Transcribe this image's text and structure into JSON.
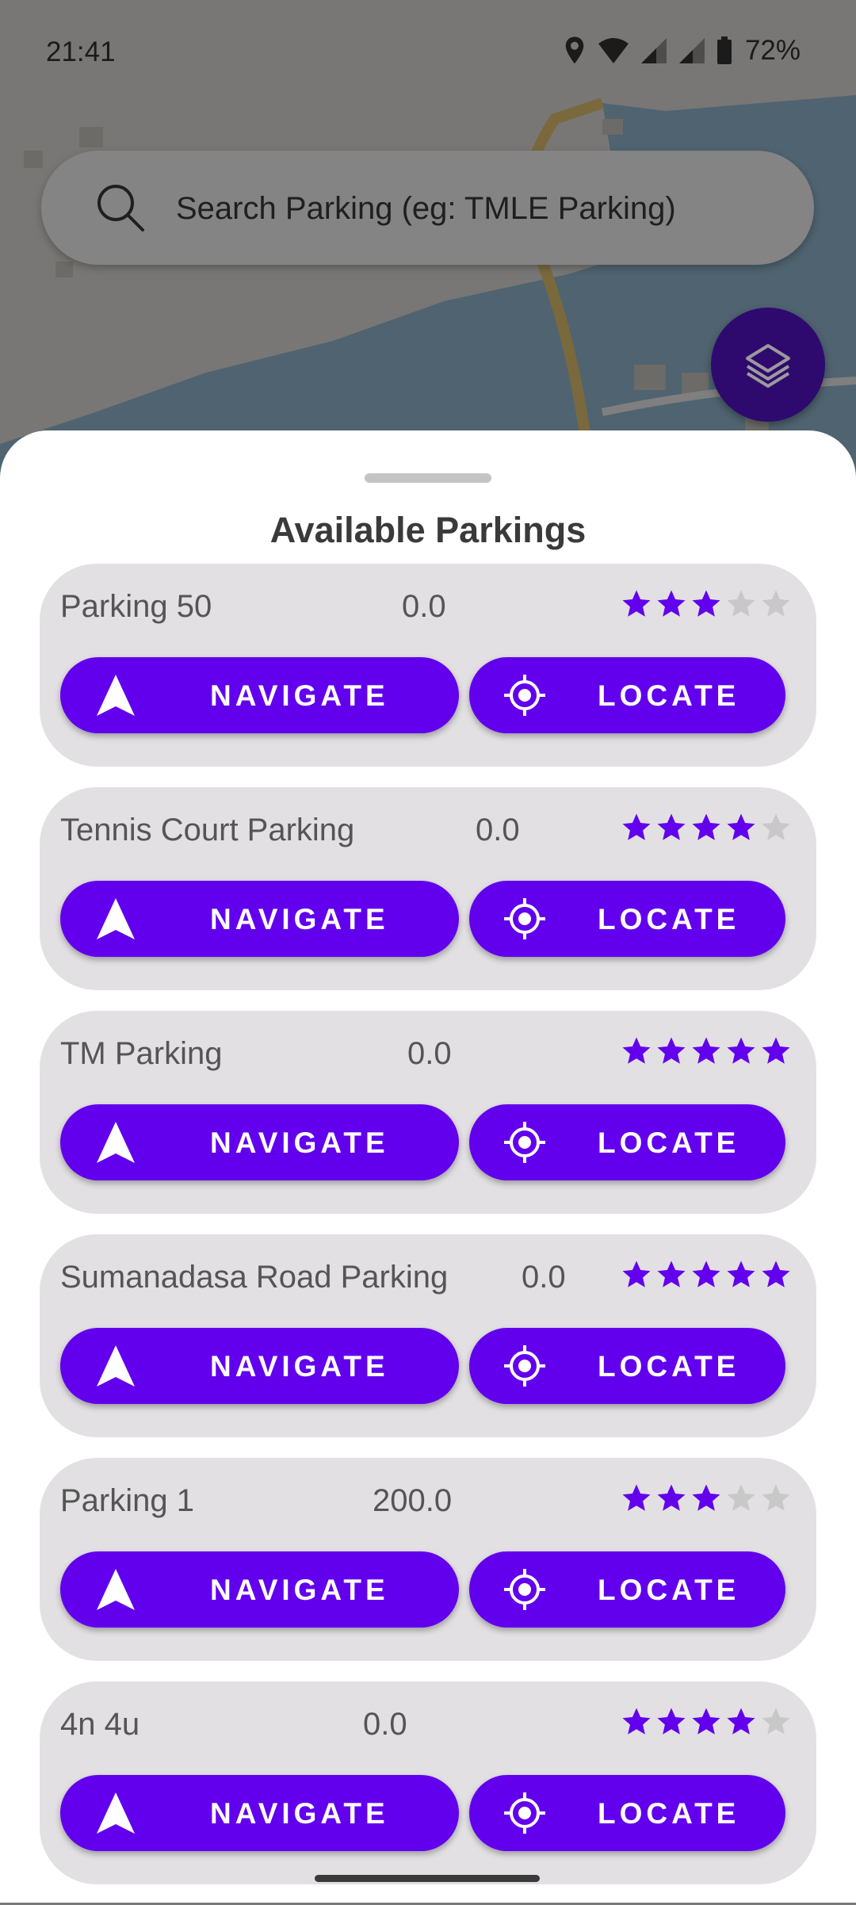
{
  "status_bar": {
    "time": "21:41",
    "battery": "72%"
  },
  "search": {
    "placeholder": "Search Parking (eg: TMLE Parking)"
  },
  "sheet": {
    "title": "Available Parkings"
  },
  "buttons": {
    "navigate": "NAVIGATE",
    "locate": "LOCATE"
  },
  "colors": {
    "accent": "#6200EE",
    "star_filled": "#6200EE",
    "star_empty": "#C8C8C8",
    "card_bg": "#E2E0E2"
  },
  "parkings": [
    {
      "name": "Parking 50",
      "price": "0.0",
      "rating": 3
    },
    {
      "name": "Tennis Court Parking",
      "price": "0.0",
      "rating": 4
    },
    {
      "name": "TM Parking",
      "price": "0.0",
      "rating": 5
    },
    {
      "name": "Sumanadasa Road Parking",
      "price": "0.0",
      "rating": 5
    },
    {
      "name": "Parking 1",
      "price": "200.0",
      "rating": 3
    },
    {
      "name": "4n 4u",
      "price": "0.0",
      "rating": 4
    }
  ],
  "max_rating": 5
}
